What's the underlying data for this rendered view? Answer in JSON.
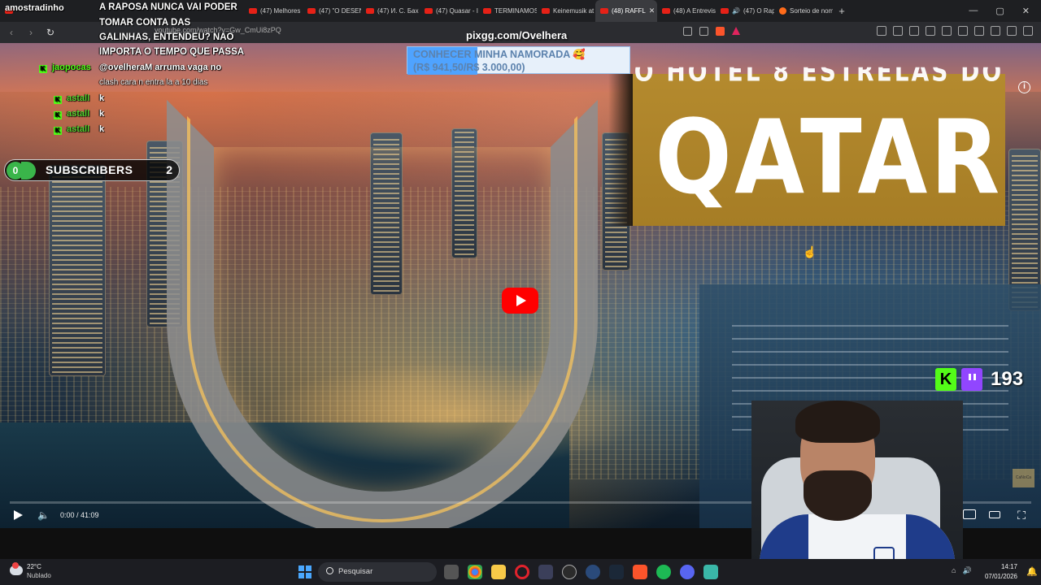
{
  "browser": {
    "tabs": [
      {
        "label": "amostradinho"
      },
      {
        "label": "(47) Melhores"
      },
      {
        "label": "(47) \"O DESENI"
      },
      {
        "label": "(47) И. С. Бах"
      },
      {
        "label": "(47) Quasar - I"
      },
      {
        "label": "TERMINAMOS"
      },
      {
        "label": "Keinemusik at"
      },
      {
        "label": "(48) RAFFL"
      },
      {
        "label": "(48) A Entrevist"
      },
      {
        "label": "(47) O Rap"
      },
      {
        "label": "Sorteio de nom"
      }
    ],
    "active_tab_index": 7,
    "new_tab": "+",
    "url": "youtube.com/watch?v=Gw_CmUi8zPQ",
    "window_controls": [
      "—",
      "▢",
      "✕"
    ]
  },
  "stream": {
    "pix_link": "pixgg.com/Ovelhera",
    "donation": {
      "line1": "CONHECER MINHA NAMORADA 🥰",
      "line2": "(R$ 941,50/R$ 3.000,00)",
      "progress": 0.3138
    },
    "chat": [
      {
        "user": "",
        "message": "A RAPOSA NUNCA VAI PODER"
      },
      {
        "user": "",
        "message": "TOMAR CONTA DAS"
      },
      {
        "user": "",
        "message": "GALINHAS, ENTENDEU? NAO"
      },
      {
        "user": "",
        "message": "IMPORTA O TEMPO QUE PASSA"
      },
      {
        "user": "jaopocas",
        "message": "@ovelheraM arruma vaga no"
      },
      {
        "user": "",
        "message": "clash cara n entra la a 10 dias"
      },
      {
        "user": "astall",
        "message": "k"
      },
      {
        "user": "astall",
        "message": "k"
      },
      {
        "user": "astall",
        "message": "k"
      }
    ],
    "subscribers": {
      "left_count": "0",
      "label": "SUBSCRIBERS",
      "right_count": "2"
    },
    "viewers": "193"
  },
  "video": {
    "thumbnail_top_text": "O HOTEL 8 ESTRELAS DO",
    "thumbnail_main_text": "QATAR",
    "time": "0:00 / 41:09",
    "watermark": "CaNoCa",
    "info": "i"
  },
  "taskbar": {
    "weather_temp": "22°C",
    "weather_desc": "Nublado",
    "search_placeholder": "Pesquisar",
    "time": "14:17",
    "date": "07/01/2026"
  },
  "colors": {
    "kick_green": "#53fc18",
    "youtube_red": "#ff0000",
    "twitch_purple": "#9146ff",
    "thumbnail_gold": "#b48a2e"
  }
}
